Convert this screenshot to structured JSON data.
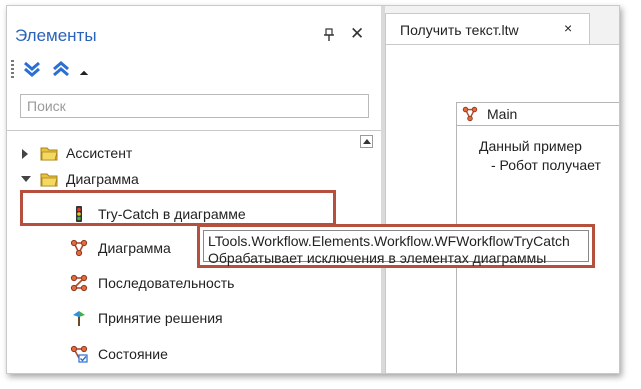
{
  "panel": {
    "title": "Элементы",
    "search_placeholder": "Поиск",
    "icons": {
      "pin": "pin-icon",
      "close": "close-icon",
      "expand_all": "expand-all-icon",
      "collapse_all": "collapse-all-icon",
      "dropdown": "dropdown-icon"
    }
  },
  "tree": {
    "items": [
      {
        "label": "Ассистент",
        "expander": "collapsed",
        "icon": "folder-icon"
      },
      {
        "label": "Диаграмма",
        "expander": "expanded",
        "icon": "folder-icon"
      },
      {
        "label": "Try-Catch в диаграмме",
        "icon": "traffic-light-icon"
      },
      {
        "label": "Диаграмма",
        "icon": "diagram-icon"
      },
      {
        "label": "Последовательность",
        "icon": "sequence-icon"
      },
      {
        "label": "Принятие решения",
        "icon": "decision-icon"
      },
      {
        "label": "Состояние",
        "icon": "state-icon"
      }
    ]
  },
  "editor": {
    "tab_label": "Получить текст.ltw",
    "tab_close": "×",
    "node_title": "Main",
    "node_description_line1": "Данный пример",
    "node_description_line2": "- Робот получает"
  },
  "tooltip": {
    "line1": "LTools.Workflow.Elements.Workflow.WFWorkflowTryCatch",
    "line2": "Обрабатывает исключения в элементах диаграммы"
  },
  "colors": {
    "title_blue": "#2a63b8",
    "highlight_red": "#b5503e",
    "folder_yellow": "#e8c13f"
  }
}
